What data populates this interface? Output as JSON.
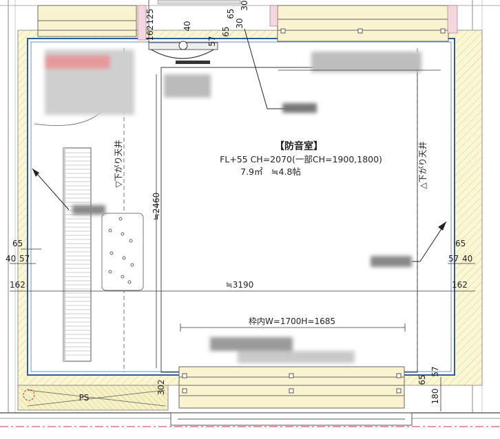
{
  "room": {
    "name": "【防音室】",
    "spec_line": "FL+55 CH=2070(一部CH=1900,1800)",
    "area_line": "7.9㎡　≒4.8帖"
  },
  "ceiling_labels": {
    "left": "▽下がり天井",
    "right": "△下がり天井"
  },
  "dimensions": {
    "top_125": "125",
    "top_162": "162",
    "top_65": "65",
    "top_30": "30",
    "top_40": "40",
    "top_57": "57",
    "top_65b": "65",
    "top_30b": "30",
    "left_65": "65",
    "left_40": "40",
    "left_57": "57",
    "left_162": "162",
    "right_65": "65",
    "right_57": "57",
    "right_40": "40",
    "right_162": "162",
    "height_2460": "≒2460",
    "width_3190": "≒3190",
    "bottom_302": "302",
    "bottom_65": "65",
    "bottom_57": "57",
    "bottom_180": "180",
    "frame": "枠内W=1700H=1685"
  },
  "ps_label": "PS"
}
